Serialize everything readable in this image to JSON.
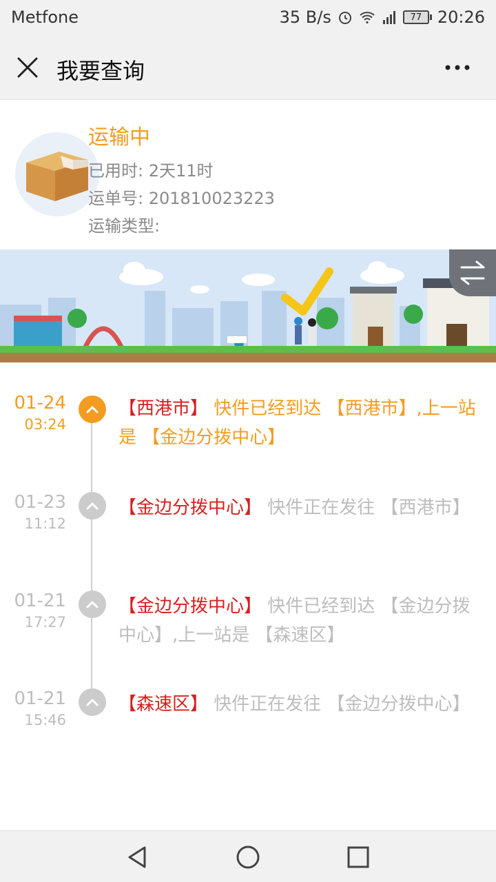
{
  "statusbar": {
    "carrier": "Metfone",
    "speed": "35 B/s",
    "battery": "77",
    "time": "20:26"
  },
  "titlebar": {
    "title": "我要查询"
  },
  "header": {
    "status": "运输中",
    "elapsed_label": "已用时: 2天11时",
    "waybill_label": "运单号: 201810023223",
    "type_label": "运输类型:"
  },
  "timeline": [
    {
      "date": "01-24",
      "time": "03:24",
      "place": "【西港市】",
      "desc": " 快件已经到达 【西港市】,上一站是 【金边分拨中心】",
      "active": true
    },
    {
      "date": "01-23",
      "time": "11:12",
      "place": "【金边分拨中心】",
      "desc": " 快件正在发往 【西港市】",
      "active": false
    },
    {
      "date": "01-21",
      "time": "17:27",
      "place": "【金边分拨中心】",
      "desc": " 快件已经到达 【金边分拨中心】,上一站是 【森速区】",
      "active": false
    },
    {
      "date": "01-21",
      "time": "15:46",
      "place": "【森速区】",
      "desc": " 快件正在发往 【金边分拨中心】",
      "active": false
    }
  ],
  "colors": {
    "accent": "#f39c1f",
    "place": "#d61f1f",
    "muted": "#bdbdbd"
  }
}
